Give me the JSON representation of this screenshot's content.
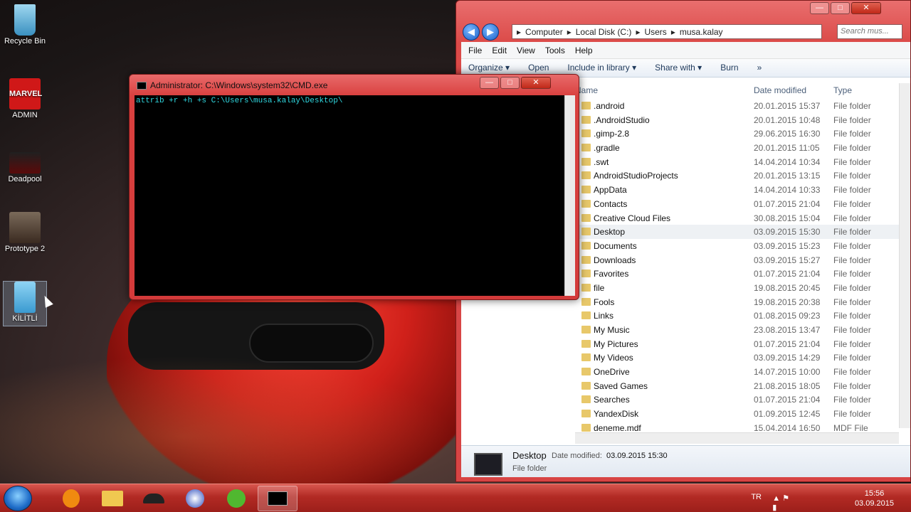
{
  "desktop": {
    "icons": [
      {
        "label": "Recycle Bin",
        "icon": "recycle-bin-icon"
      },
      {
        "label": "ADMIN",
        "icon": "marvel-icon"
      },
      {
        "label": "Deadpool",
        "icon": "deadpool-icon"
      },
      {
        "label": "Prototype 2",
        "icon": "prototype-icon"
      },
      {
        "label": "KİLİTLİ",
        "icon": "folder-icon"
      }
    ]
  },
  "cmd": {
    "title": "Administrator: C:\\Windows\\system32\\CMD.exe",
    "command": "attrib +r +h +s C:\\Users\\musa.kalay\\Desktop\\",
    "buttons": {
      "minimize": "—",
      "maximize": "□",
      "close": "✕"
    }
  },
  "explorer": {
    "breadcrumb": [
      "Computer",
      "Local Disk (C:)",
      "Users",
      "musa.kalay"
    ],
    "search_placeholder": "Search mus...",
    "menu": [
      "File",
      "Edit",
      "View",
      "Tools",
      "Help"
    ],
    "toolbar": [
      "Organize ▾",
      "Open",
      "Include in library ▾",
      "Share with ▾",
      "Burn",
      "»"
    ],
    "columns": {
      "name": "Name",
      "date": "Date modified",
      "type": "Type"
    },
    "files": [
      {
        "name": ".android",
        "date": "20.01.2015 15:37",
        "type": "File folder"
      },
      {
        "name": ".AndroidStudio",
        "date": "20.01.2015 10:48",
        "type": "File folder"
      },
      {
        "name": ".gimp-2.8",
        "date": "29.06.2015 16:30",
        "type": "File folder"
      },
      {
        "name": ".gradle",
        "date": "20.01.2015 11:05",
        "type": "File folder"
      },
      {
        "name": ".swt",
        "date": "14.04.2014 10:34",
        "type": "File folder"
      },
      {
        "name": "AndroidStudioProjects",
        "date": "20.01.2015 13:15",
        "type": "File folder"
      },
      {
        "name": "AppData",
        "date": "14.04.2014 10:33",
        "type": "File folder"
      },
      {
        "name": "Contacts",
        "date": "01.07.2015 21:04",
        "type": "File folder"
      },
      {
        "name": "Creative Cloud Files",
        "date": "30.08.2015 15:04",
        "type": "File folder"
      },
      {
        "name": "Desktop",
        "date": "03.09.2015 15:30",
        "type": "File folder"
      },
      {
        "name": "Documents",
        "date": "03.09.2015 15:23",
        "type": "File folder"
      },
      {
        "name": "Downloads",
        "date": "03.09.2015 15:27",
        "type": "File folder"
      },
      {
        "name": "Favorites",
        "date": "01.07.2015 21:04",
        "type": "File folder"
      },
      {
        "name": "file",
        "date": "19.08.2015 20:45",
        "type": "File folder"
      },
      {
        "name": "Fools",
        "date": "19.08.2015 20:38",
        "type": "File folder"
      },
      {
        "name": "Links",
        "date": "01.08.2015 09:23",
        "type": "File folder"
      },
      {
        "name": "My Music",
        "date": "23.08.2015 13:47",
        "type": "File folder"
      },
      {
        "name": "My Pictures",
        "date": "01.07.2015 21:04",
        "type": "File folder"
      },
      {
        "name": "My Videos",
        "date": "03.09.2015 14:29",
        "type": "File folder"
      },
      {
        "name": "OneDrive",
        "date": "14.07.2015 10:00",
        "type": "File folder"
      },
      {
        "name": "Saved Games",
        "date": "21.08.2015 18:05",
        "type": "File folder"
      },
      {
        "name": "Searches",
        "date": "01.07.2015 21:04",
        "type": "File folder"
      },
      {
        "name": "YandexDisk",
        "date": "01.09.2015 12:45",
        "type": "File folder"
      },
      {
        "name": "deneme.mdf",
        "date": "15.04.2014 16:50",
        "type": "MDF File"
      }
    ],
    "details": {
      "name": "Desktop",
      "modified_label": "Date modified:",
      "modified": "03.09.2015 15:30",
      "type": "File folder"
    }
  },
  "taskbar": {
    "lang": "TR",
    "time": "15:56",
    "date": "03.09.2015",
    "apps": [
      "avast-icon",
      "explorer-icon",
      "ninja-icon",
      "compass-icon",
      "utorrent-icon",
      "cmd-icon"
    ]
  }
}
